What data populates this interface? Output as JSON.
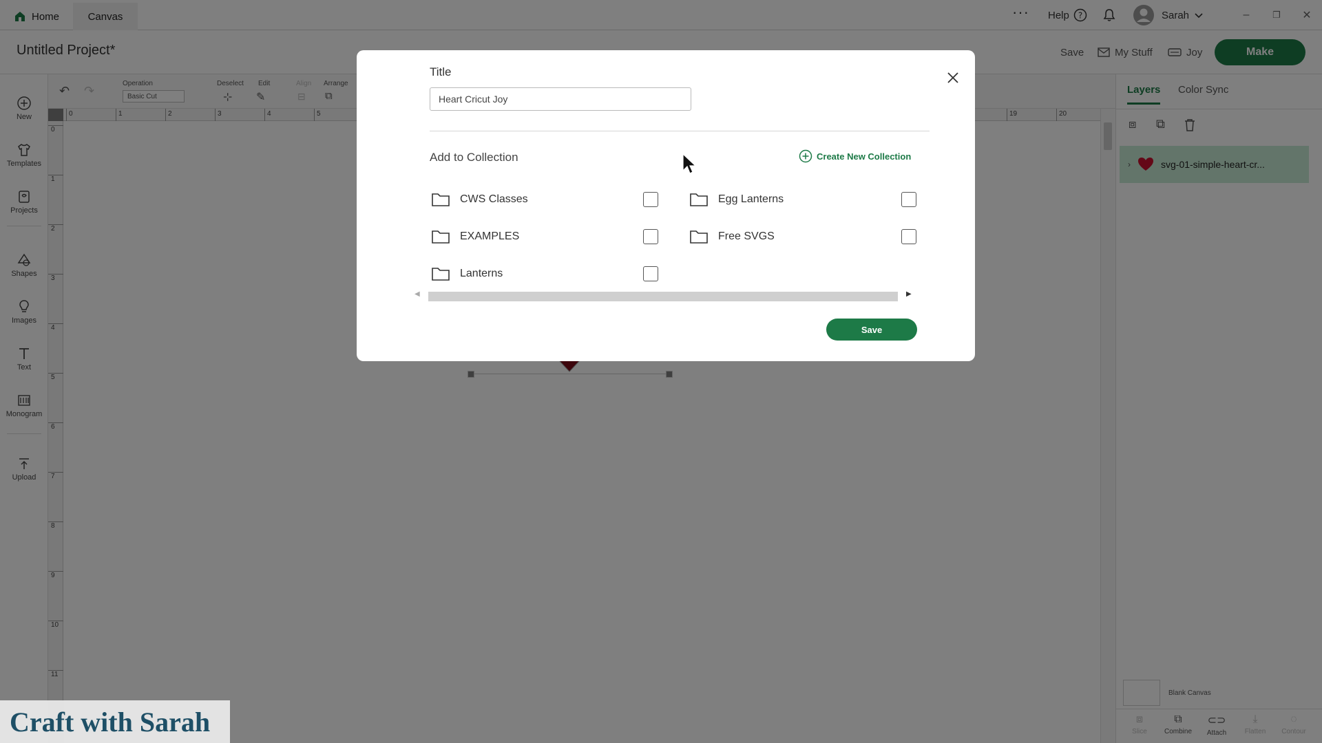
{
  "tabs": {
    "home": "Home",
    "canvas": "Canvas"
  },
  "topbar": {
    "help": "Help",
    "user_name": "Sarah"
  },
  "project": {
    "title": "Untitled Project*"
  },
  "header_actions": {
    "save": "Save",
    "my_stuff": "My Stuff",
    "machine": "Joy",
    "make": "Make"
  },
  "left_rail": [
    {
      "label": "New",
      "icon": "plus-circle-icon"
    },
    {
      "label": "Templates",
      "icon": "shirt-icon"
    },
    {
      "label": "Projects",
      "icon": "projects-icon"
    },
    {
      "label": "Shapes",
      "icon": "shapes-icon"
    },
    {
      "label": "Images",
      "icon": "lightbulb-icon"
    },
    {
      "label": "Text",
      "icon": "text-icon"
    },
    {
      "label": "Monogram",
      "icon": "monogram-icon"
    },
    {
      "label": "Upload",
      "icon": "upload-icon"
    }
  ],
  "toolbar": {
    "operation_label": "Operation",
    "operation_value": "Basic Cut",
    "deselect_label": "Deselect",
    "edit_label": "Edit",
    "align_label": "Align",
    "arrange_label": "Arrange"
  },
  "ruler": {
    "h": [
      "0",
      "1",
      "2",
      "3",
      "4",
      "5",
      "19",
      "20"
    ],
    "v": [
      "0",
      "1",
      "2",
      "3",
      "4",
      "5",
      "6",
      "7",
      "8",
      "9",
      "10",
      "11"
    ]
  },
  "right_panel": {
    "tabs": [
      "Layers",
      "Color Sync"
    ],
    "layer_name": "svg-01-simple-heart-cr...",
    "blank_canvas": "Blank Canvas",
    "bottom_actions": [
      "Slice",
      "Combine",
      "Attach",
      "Flatten",
      "Contour"
    ]
  },
  "modal": {
    "title_label": "Title",
    "title_value": "Heart Cricut Joy",
    "add_to_collection": "Add to Collection",
    "create_new_collection": "Create New Collection",
    "collections": [
      {
        "name": "CWS Classes",
        "checked": false
      },
      {
        "name": "Egg Lanterns",
        "checked": false
      },
      {
        "name": "EXAMPLES",
        "checked": false
      },
      {
        "name": "Free SVGS",
        "checked": false
      },
      {
        "name": "Lanterns",
        "checked": false
      }
    ],
    "save_button": "Save"
  },
  "watermark": "Craft with Sarah",
  "colors": {
    "accent": "#1d7a47",
    "layer_highlight": "#c6ead4",
    "heart": "#c8102e"
  }
}
